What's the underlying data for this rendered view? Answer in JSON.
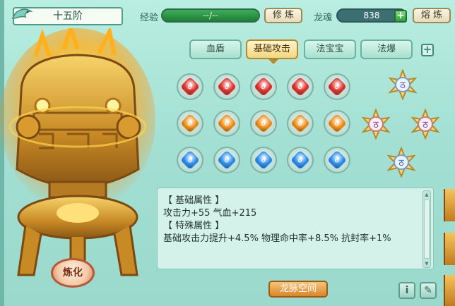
{
  "header": {
    "rank": "十五阶",
    "exp_label": "经验",
    "exp_value": "--/--",
    "cultivate_button": "修 炼",
    "soul_label": "龙魂",
    "soul_value": "838",
    "smelt_button": "熔 炼"
  },
  "tabs": [
    {
      "label": "血盾",
      "active": false
    },
    {
      "label": "基础攻击",
      "active": true
    },
    {
      "label": "法宝宝",
      "active": false
    },
    {
      "label": "法爆",
      "active": false
    }
  ],
  "gem_rows": [
    {
      "color": "red",
      "hex": "#e0322c",
      "count": 5
    },
    {
      "color": "orange",
      "hex": "#f3911b",
      "count": 5
    },
    {
      "color": "blue",
      "hex": "#2b8ff0",
      "count": 5
    }
  ],
  "refine_button": "炼化",
  "stats": {
    "basic_header": "【 基础属性 】",
    "basic_values": "攻击力+55  气血+215",
    "special_header": "【 特殊属性 】",
    "special_values": "基础攻击力提升+4.5%  物理命中率+8.5%  抗封率+1%"
  },
  "vein_button": "龙脉空间",
  "icons": [
    "info-icon",
    "notebook-icon"
  ]
}
